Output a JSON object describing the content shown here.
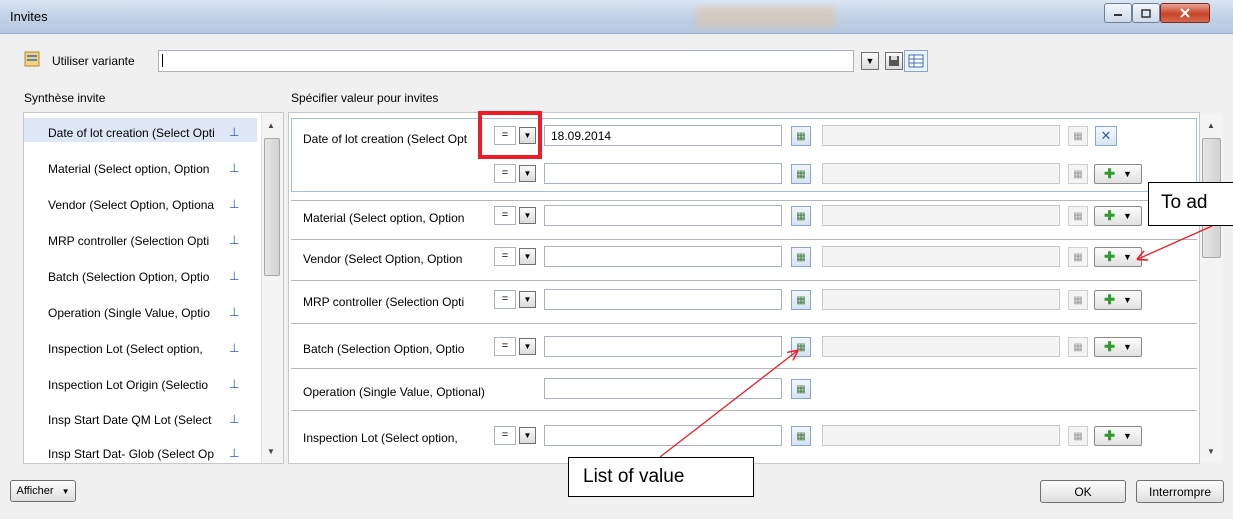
{
  "window": {
    "title": "Invites"
  },
  "variant": {
    "label": "Utiliser variante",
    "value": ""
  },
  "headers": {
    "left": "Synthèse invite",
    "right": "Spécifier valeur pour invites"
  },
  "left_items": [
    "Date of lot creation (Select Opti",
    "Material (Select option, Option",
    "Vendor (Select Option, Optiona",
    "MRP controller (Selection Opti",
    "Batch (Selection Option, Optio",
    "Operation (Single Value, Optio",
    "Inspection Lot (Select option,",
    "Inspection Lot Origin (Selectio",
    "Insp Start Date QM Lot (Select",
    "Insp Start Dat- Glob (Select Op"
  ],
  "rows": {
    "date": {
      "label": "Date of lot creation (Select Opt",
      "op": "=",
      "value": "18.09.2014",
      "op2": "="
    },
    "material": {
      "label": "Material (Select option, Option",
      "op": "="
    },
    "vendor": {
      "label": "Vendor (Select Option, Option",
      "op": "="
    },
    "mrp": {
      "label": "MRP controller (Selection Opti",
      "op": "="
    },
    "batch": {
      "label": "Batch (Selection Option, Optio",
      "op": "="
    },
    "operation": {
      "label": "Operation (Single Value, Optional)"
    },
    "inspection": {
      "label": "Inspection Lot (Select option,",
      "op": "="
    }
  },
  "buttons": {
    "show": "Afficher",
    "ok": "OK",
    "cancel": "Interrompre"
  },
  "annotations": {
    "add": "To ad",
    "lov": "List of value"
  },
  "colors": {
    "highlight": "#ee1c24",
    "selection": "#dde7f5",
    "pin": "#2e5fb8"
  }
}
